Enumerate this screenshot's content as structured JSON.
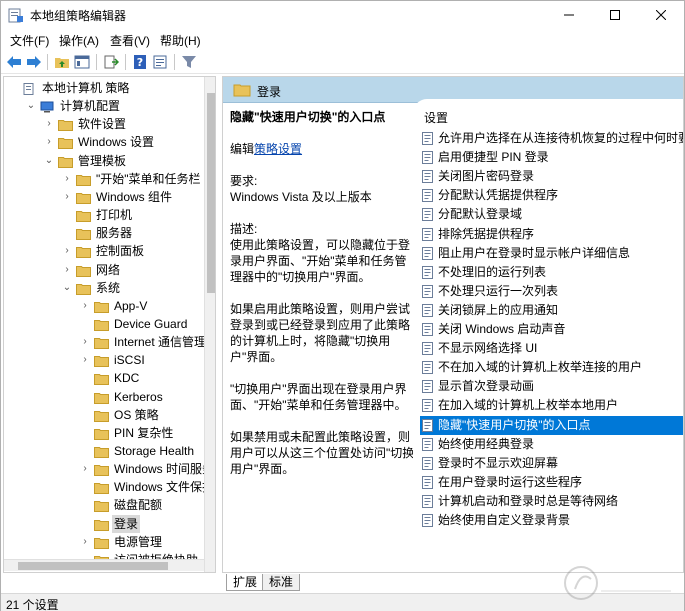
{
  "window": {
    "title": "本地组策略编辑器",
    "minimize": "—",
    "maximize": "☐",
    "close": "✕"
  },
  "menu": [
    "文件(F)",
    "操作(A)",
    "查看(V)",
    "帮助(H)"
  ],
  "tree": {
    "items": [
      {
        "label": "本地计算机 策略",
        "arrow": "",
        "level": 0,
        "icon": "policy-doc-icon"
      },
      {
        "label": "计算机配置",
        "arrow": "⌄",
        "level": 1,
        "icon": "computer-icon"
      },
      {
        "label": "软件设置",
        "arrow": "›",
        "level": 2,
        "icon": "folder-icon"
      },
      {
        "label": "Windows 设置",
        "arrow": "›",
        "level": 2,
        "icon": "folder-icon"
      },
      {
        "label": "管理模板",
        "arrow": "⌄",
        "level": 2,
        "icon": "folder-icon"
      },
      {
        "label": "\"开始\"菜单和任务栏",
        "arrow": "›",
        "level": 3,
        "icon": "folder-icon"
      },
      {
        "label": "Windows 组件",
        "arrow": "›",
        "level": 3,
        "icon": "folder-icon"
      },
      {
        "label": "打印机",
        "arrow": "",
        "level": 3,
        "icon": "folder-icon"
      },
      {
        "label": "服务器",
        "arrow": "",
        "level": 3,
        "icon": "folder-icon"
      },
      {
        "label": "控制面板",
        "arrow": "›",
        "level": 3,
        "icon": "folder-icon"
      },
      {
        "label": "网络",
        "arrow": "›",
        "level": 3,
        "icon": "folder-icon"
      },
      {
        "label": "系统",
        "arrow": "⌄",
        "level": 3,
        "icon": "folder-icon"
      },
      {
        "label": "App-V",
        "arrow": "›",
        "level": 4,
        "icon": "folder-icon"
      },
      {
        "label": "Device Guard",
        "arrow": "",
        "level": 4,
        "icon": "folder-icon"
      },
      {
        "label": "Internet 通信管理",
        "arrow": "›",
        "level": 4,
        "icon": "folder-icon"
      },
      {
        "label": "iSCSI",
        "arrow": "›",
        "level": 4,
        "icon": "folder-icon"
      },
      {
        "label": "KDC",
        "arrow": "",
        "level": 4,
        "icon": "folder-icon"
      },
      {
        "label": "Kerberos",
        "arrow": "",
        "level": 4,
        "icon": "folder-icon"
      },
      {
        "label": "OS 策略",
        "arrow": "",
        "level": 4,
        "icon": "folder-icon"
      },
      {
        "label": "PIN 复杂性",
        "arrow": "",
        "level": 4,
        "icon": "folder-icon"
      },
      {
        "label": "Storage Health",
        "arrow": "",
        "level": 4,
        "icon": "folder-icon"
      },
      {
        "label": "Windows 时间服务",
        "arrow": "›",
        "level": 4,
        "icon": "folder-icon"
      },
      {
        "label": "Windows 文件保护",
        "arrow": "",
        "level": 4,
        "icon": "folder-icon"
      },
      {
        "label": "磁盘配额",
        "arrow": "",
        "level": 4,
        "icon": "folder-icon"
      },
      {
        "label": "登录",
        "arrow": "",
        "level": 4,
        "icon": "folder-icon",
        "selected": true
      },
      {
        "label": "电源管理",
        "arrow": "›",
        "level": 4,
        "icon": "folder-icon"
      },
      {
        "label": "访问被拒绝协助",
        "arrow": "",
        "level": 4,
        "icon": "folder-icon"
      }
    ]
  },
  "right": {
    "header": "登录",
    "desc_title": "隐藏\"快速用户切换\"的入口点",
    "edit_prefix": "编辑",
    "edit_link": "策略设置",
    "req_label": "要求:",
    "req_value": "Windows Vista 及以上版本",
    "desc_label": "描述:",
    "desc_p1": "使用此策略设置，可以隐藏位于登录用户界面、\"开始\"菜单和任务管理器中的\"切换用户\"界面。",
    "desc_p2": "如果启用此策略设置，则用户尝试登录到或已经登录到应用了此策略的计算机上时，将隐藏\"切换用户\"界面。",
    "desc_p3": "\"切换用户\"界面出现在登录用户界面、\"开始\"菜单和任务管理器中。",
    "desc_p4": "如果禁用或未配置此策略设置，则用户可以从这三个位置处访问\"切换用户\"界面。",
    "list_header": "设置",
    "settings": [
      "允许用户选择在从连接待机恢复的过程中何时要求提",
      "启用便捷型 PIN 登录",
      "关闭图片密码登录",
      "分配默认凭据提供程序",
      "分配默认登录域",
      "排除凭据提供程序",
      "阻止用户在登录时显示帐户详细信息",
      "不处理旧的运行列表",
      "不处理只运行一次列表",
      "关闭锁屏上的应用通知",
      "关闭 Windows 启动声音",
      "不显示网络选择 UI",
      "不在加入域的计算机上枚举连接的用户",
      "显示首次登录动画",
      "在加入域的计算机上枚举本地用户",
      "隐藏\"快速用户切换\"的入口点",
      "始终使用经典登录",
      "登录时不显示欢迎屏幕",
      "在用户登录时运行这些程序",
      "计算机启动和登录时总是等待网络",
      "始终使用自定义登录背景"
    ],
    "selected_index": 15
  },
  "tabs": [
    "扩展",
    "标准"
  ],
  "status": "21 个设置",
  "colors": {
    "selection": "#0078d7",
    "header": "#b9d7ea",
    "folder": "#e8c25a"
  }
}
